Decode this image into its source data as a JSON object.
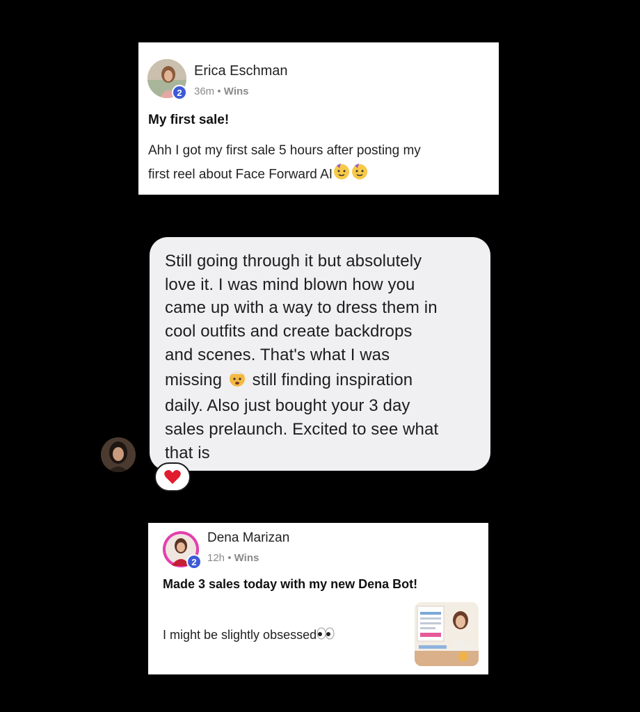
{
  "posts": [
    {
      "author": "Erica Eschman",
      "badge": "2",
      "time": "36m",
      "separator": "•",
      "category": "Wins",
      "title": "My first sale!",
      "body_line1": "Ahh I got my first sale 5 hours after posting my",
      "body_line2": "first reel about Face Forward AI"
    },
    {
      "author": "Dena Marizan",
      "badge": "2",
      "time": "12h",
      "separator": "•",
      "category": "Wins",
      "title": "Made 3 sales today with my new Dena Bot!",
      "body": "I might be slightly obsessed"
    }
  ],
  "message": {
    "line1": "Still going through it but absolutely",
    "line2": "love it. I was mind blown how you",
    "line3": "came up with a way to dress them in",
    "line4": "cool outfits and create backdrops",
    "line5": "and scenes. That's what I was",
    "line6a": "missing",
    "line6b": "still finding inspiration",
    "line7": "daily. Also just bought your 3 day",
    "line8": "sales prelaunch. Excited to see what",
    "line9": "that is",
    "reaction_icon": "heart-icon"
  }
}
